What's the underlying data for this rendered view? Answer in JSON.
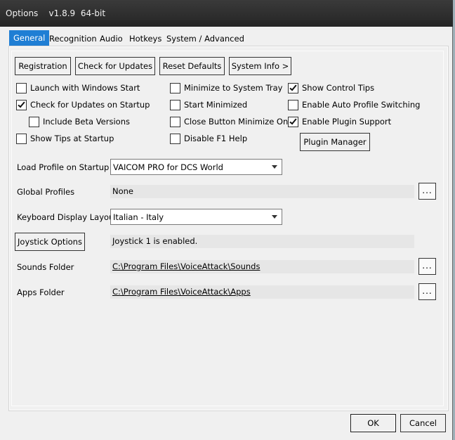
{
  "titlebar": {
    "title": "Options    v1.8.9  64-bit"
  },
  "tabs": [
    {
      "label": "General",
      "active": true
    },
    {
      "label": "Recognition"
    },
    {
      "label": "Audio"
    },
    {
      "label": "Hotkeys"
    },
    {
      "label": "System / Advanced"
    }
  ],
  "buttons": {
    "registration": "Registration",
    "check_updates": "Check for Updates",
    "reset_defaults": "Reset Defaults",
    "system_info": "System Info >",
    "plugin_manager": "Plugin Manager",
    "joystick_options": "Joystick Options",
    "ok": "OK",
    "cancel": "Cancel"
  },
  "checkboxes": {
    "launch_windows_start": {
      "label": "Launch with Windows Start",
      "checked": false
    },
    "check_updates_startup": {
      "label": "Check for Updates on Startup",
      "checked": true
    },
    "include_beta": {
      "label": "Include Beta Versions",
      "checked": false
    },
    "show_tips_startup": {
      "label": "Show Tips at Startup",
      "checked": false
    },
    "minimize_tray": {
      "label": "Minimize to System Tray",
      "checked": false
    },
    "start_minimized": {
      "label": "Start Minimized",
      "checked": false
    },
    "close_minimize_only": {
      "label": "Close Button Minimize Only",
      "checked": false
    },
    "disable_f1": {
      "label": "Disable F1 Help",
      "checked": false
    },
    "show_control_tips": {
      "label": "Show Control Tips",
      "checked": true
    },
    "auto_profile_switching": {
      "label": "Enable Auto Profile Switching",
      "checked": false
    },
    "plugin_support": {
      "label": "Enable Plugin Support",
      "checked": true
    }
  },
  "settings": {
    "load_profile_label": "Load Profile on Startup",
    "load_profile_value": "VAICOM PRO for DCS World",
    "global_profiles_label": "Global Profiles",
    "global_profiles_value": "None",
    "keyboard_layout_label": "Keyboard Display Layout",
    "keyboard_layout_value": "Italian - Italy",
    "joystick_status": "Joystick 1 is enabled.",
    "sounds_folder_label": "Sounds Folder",
    "sounds_folder_value": "C:\\Program Files\\VoiceAttack\\Sounds",
    "apps_folder_label": "Apps Folder",
    "apps_folder_value": "C:\\Program Files\\VoiceAttack\\Apps",
    "browse_label": "..."
  }
}
